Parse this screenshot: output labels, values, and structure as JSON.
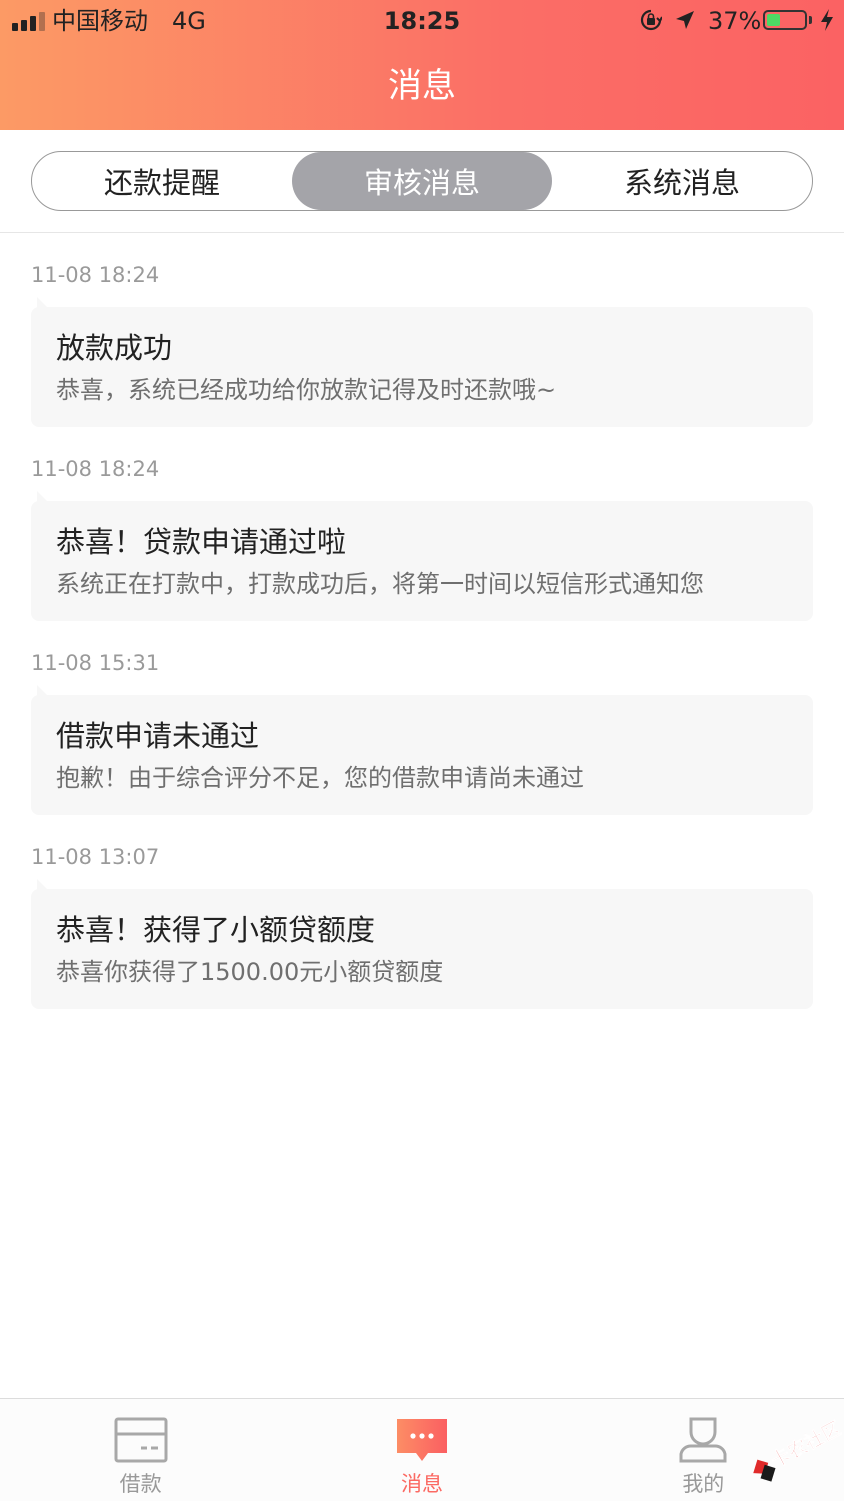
{
  "status_bar": {
    "carrier": "中国移动",
    "network": "4G",
    "time": "18:25",
    "battery_percent": "37%",
    "battery_level": 0.37,
    "icons": [
      "signal-icon",
      "orientation-lock-icon",
      "location-arrow-icon",
      "battery-icon",
      "charging-bolt-icon"
    ]
  },
  "header": {
    "title": "消息"
  },
  "tabs": [
    {
      "label": "还款提醒",
      "active": false
    },
    {
      "label": "审核消息",
      "active": true
    },
    {
      "label": "系统消息",
      "active": false
    }
  ],
  "messages": [
    {
      "time": "11-08 18:24",
      "title": "放款成功",
      "body": "恭喜，系统已经成功给你放款记得及时还款哦~"
    },
    {
      "time": "11-08 18:24",
      "title": "恭喜！贷款申请通过啦",
      "body": "系统正在打款中，打款成功后，将第一时间以短信形式通知您"
    },
    {
      "time": "11-08 15:31",
      "title": "借款申请未通过",
      "body": "抱歉！由于综合评分不足，您的借款申请尚未通过"
    },
    {
      "time": "11-08 13:07",
      "title": "恭喜！获得了小额贷额度",
      "body": "恭喜你获得了1500.00元小额贷额度"
    }
  ],
  "tabbar": {
    "items": [
      {
        "label": "借款",
        "icon": "card-icon",
        "active": false
      },
      {
        "label": "消息",
        "icon": "chat-bubble-icon",
        "active": true
      },
      {
        "label": "我的",
        "icon": "person-icon",
        "active": false
      }
    ]
  },
  "watermark": {
    "text": "卡农社区",
    "icon": "kanong-logo-icon"
  },
  "colors": {
    "header_start": "#fc9a65",
    "header_end": "#fb6263",
    "accent": "#fb6a63",
    "segment_active": "#a4a4a9",
    "card_bg": "#f7f7f7",
    "muted_text": "#9a9a9a"
  }
}
